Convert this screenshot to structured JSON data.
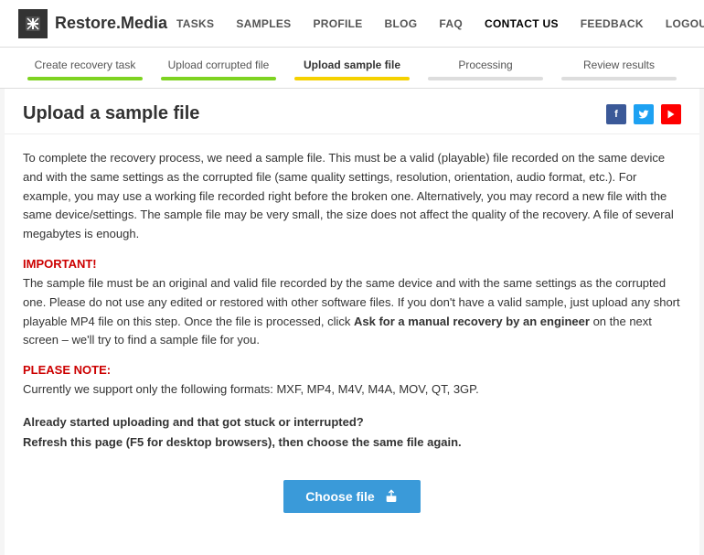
{
  "header": {
    "logo_text": "Restore.Media",
    "nav_items": [
      {
        "label": "TASKS",
        "id": "tasks"
      },
      {
        "label": "SAMPLES",
        "id": "samples"
      },
      {
        "label": "PROFILE",
        "id": "profile"
      },
      {
        "label": "BLOG",
        "id": "blog"
      },
      {
        "label": "FAQ",
        "id": "faq"
      },
      {
        "label": "CONTACT US",
        "id": "contact"
      },
      {
        "label": "FEEDBACK",
        "id": "feedback"
      },
      {
        "label": "LOGOUT",
        "id": "logout"
      }
    ]
  },
  "steps": [
    {
      "label": "Create recovery task",
      "line": "green"
    },
    {
      "label": "Upload corrupted file",
      "line": "green"
    },
    {
      "label": "Upload sample file",
      "line": "yellow",
      "active": true
    },
    {
      "label": "Processing",
      "line": "gray"
    },
    {
      "label": "Review results",
      "line": "gray"
    }
  ],
  "page": {
    "title": "Upload a sample file",
    "social": [
      "f",
      "t",
      "▶"
    ],
    "desc": "To complete the recovery process, we need a sample file. This must be a valid (playable) file recorded on the same device and with the same settings as the corrupted file (same quality settings, resolution, orientation, audio format, etc.). For example, you may use a working file recorded right before the broken one. Alternatively, you may record a new file with the same device/settings. The sample file may be very small, the size does not affect the quality of the recovery. A file of several megabytes is enough.",
    "important_label": "IMPORTANT!",
    "important_text_1": "The sample file must be an original and valid file recorded by the same device and with the same settings as the corrupted one. Please do not use any edited or restored with other software files. If you don't have a valid sample, just upload any short playable MP4 file on this step. Once the file is processed, click ",
    "important_link": "Ask for a manual recovery by an engineer",
    "important_text_2": " on the next screen – we'll try to find a sample file for you.",
    "note_label": "PLEASE NOTE:",
    "note_text": "Currently we support only the following formats: MXF, MP4, M4V, M4A, MOV, QT, 3GP.",
    "stuck_line1": "Already started uploading and that got stuck or interrupted?",
    "stuck_line2": "Refresh this page (F5 for desktop browsers), then choose the same file again.",
    "choose_btn": "Choose file"
  }
}
